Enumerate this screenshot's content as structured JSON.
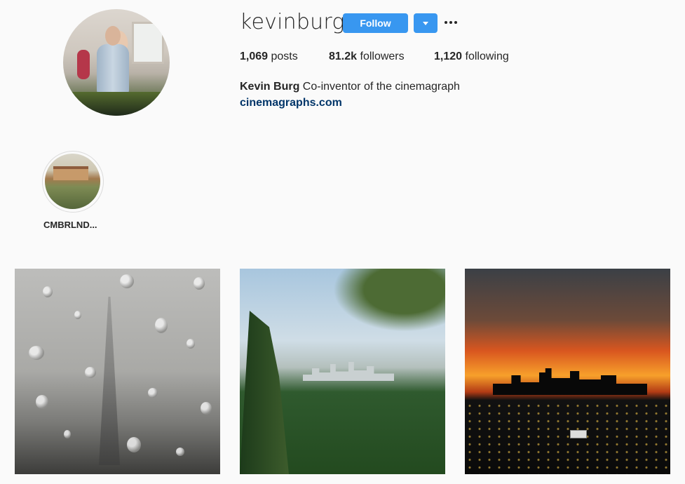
{
  "profile": {
    "username": "kevinburg",
    "follow_label": "Follow",
    "stats": {
      "posts_count": "1,069",
      "posts_label": "posts",
      "followers_count": "81.2k",
      "followers_label": "followers",
      "following_count": "1,120",
      "following_label": "following"
    },
    "full_name": "Kevin Burg",
    "bio": "Co-inventor of the cinemagraph",
    "website": "cinemagraphs.com"
  },
  "highlights": [
    {
      "label": "CMBRLND..."
    }
  ],
  "posts": [
    {
      "subject": "rain drops on window with eiffel tower"
    },
    {
      "subject": "los angeles skyline through trees"
    },
    {
      "subject": "los angeles skyline at sunset"
    }
  ],
  "colors": {
    "accent": "#3897f0",
    "link": "#003569",
    "background": "#fafafa",
    "text": "#262626"
  },
  "icons": {
    "dropdown": "triangle-down",
    "more": "ellipsis-horizontal"
  }
}
